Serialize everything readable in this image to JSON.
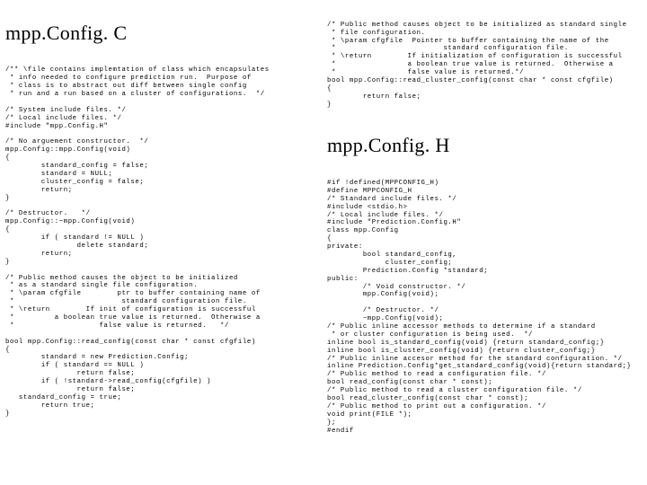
{
  "left": {
    "title": "mpp.Config. C",
    "code": "/** \\file contains implemtation of class which encapsulates\n * info needed to configure prediction run.  Purpose of\n * class is to abstract out diff between single config\n * run and a run based on a cluster of configurations.  */\n\n/* System include files. */\n/* Local include files. */\n#include \"mpp.Config.H\"\n\n/* No arguement constructor.  */\nmpp.Config::mpp.Config(void)\n{\n        standard_config = false;\n        standard = NULL;\n        cluster_config = false;\n        return;\n}\n\n/* Destructor.   */\nmpp.Config::~mpp.Config(void)\n{\n        if ( standard != NULL )\n                delete standard;\n        return;\n}\n\n/* Public method causes the object to be initialized\n * as a standard single file configuration.\n * \\param cfgfile        ptr to buffer containing name of\n *                        standard configuration file.\n * \\return        If init of configuration is successful\n *         a boolean true value is returned.  Otherwise a\n *                   false value is returned.   */\n\nbool mpp.Config::read_config(const char * const cfgfile)\n{\n        standard = new Prediction.Config;\n        if ( standard == NULL )\n                return false;\n        if ( !standard->read_config(cfgfile) )\n                return false;\n   standard_config = true;\n        return true;\n}"
  },
  "right": {
    "pre": "/* Public method causes object to be initialized as standard single\n * file configuration.\n * \\param cfgfile  Pointer to buffer containing the name of the\n *                        standard configuration file.\n * \\return        If initialization of configuration is successful\n *                a boolean true value is returned.  Otherwise a\n *                false value is returned.*/\nbool mpp.Config::read_cluster_config(const char * const cfgfile)\n{\n        return false;\n}",
    "title": "mpp.Config. H",
    "code": "#if !defined(MPPCONFIG_H)\n#define MPPCONFIG_H\n/* Standard include files. */\n#include <stdio.h>\n/* Local include files. */\n#include \"Prediction.Config.H\"\nclass mpp.Config\n{\nprivate:\n        bool standard_config,\n             cluster_config;\n        Prediction.Config *standard;\npublic:\n        /* Void constructor. */\n        mpp.Config(void);\n\n        /* Destructor. */\n        ~mpp.Config(void);\n/* Public inline accessor methods to determine if a standard\n * or cluster configuration is being used.  */\ninline bool is_standard_config(void) {return standard_config;}\ninline bool is_cluster_config(void) {return cluster_config;}\n/* Public inline accesor method for the standard configuration. */\ninline Prediction.Config*get_standard_config(void){return standard;}\n/* Public method to read a configuration file. */\nbool read_config(const char * const);\n/* Public method to read a cluster configuration file. */\nbool read_cluster_config(const char * const);\n/* Public method to print out a configuration. */\nvoid print(FILE *);\n};\n#endif"
  }
}
